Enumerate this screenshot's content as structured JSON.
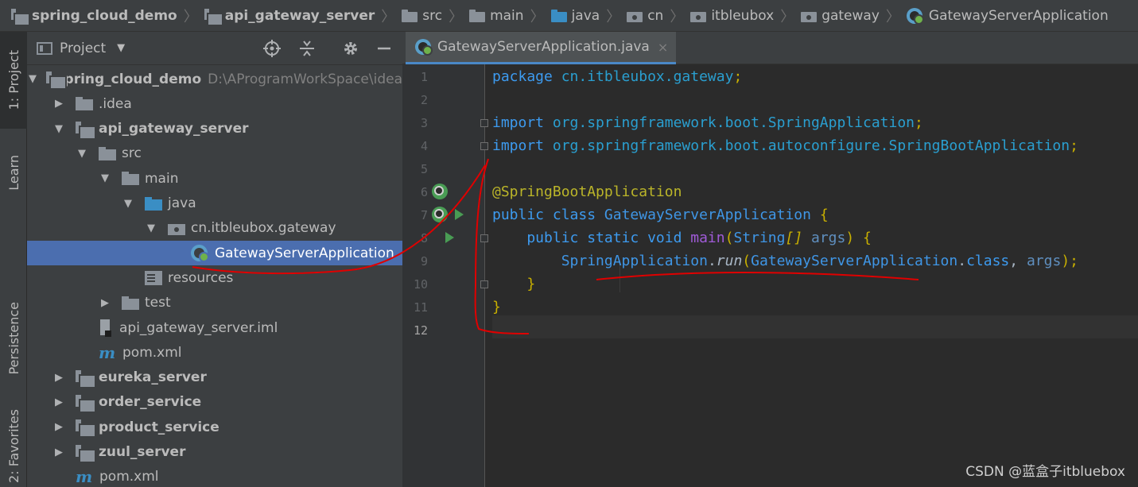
{
  "breadcrumb": [
    {
      "label": "spring_cloud_demo",
      "icon": "module-icon",
      "bold": true
    },
    {
      "label": "api_gateway_server",
      "icon": "module-icon",
      "bold": true
    },
    {
      "label": "src",
      "icon": "folder-icon",
      "bold": false
    },
    {
      "label": "main",
      "icon": "folder-icon",
      "bold": false
    },
    {
      "label": "java",
      "icon": "source-folder-icon",
      "bold": false
    },
    {
      "label": "cn",
      "icon": "package-icon",
      "bold": false
    },
    {
      "label": "itbleubox",
      "icon": "package-icon",
      "bold": false
    },
    {
      "label": "gateway",
      "icon": "package-icon",
      "bold": false
    },
    {
      "label": "GatewayServerApplication",
      "icon": "spring-boot-class-icon",
      "bold": false
    }
  ],
  "tool_strip": {
    "project_tab": "1: Project",
    "learn_tab": "Learn",
    "persistence_tab": "Persistence",
    "favorites_tab": "2: Favorites"
  },
  "project_panel": {
    "title": "Project",
    "dropdown_glyph": "▼",
    "tree": [
      {
        "label": "spring_cloud_demo",
        "path": "D:\\AProgramWorkSpace\\idea",
        "icon": "module",
        "arrow": "▼",
        "bold": true,
        "depth": 0
      },
      {
        "label": ".idea",
        "icon": "folder",
        "arrow": "▶",
        "bold": false,
        "depth": 1
      },
      {
        "label": "api_gateway_server",
        "icon": "module",
        "arrow": "▼",
        "bold": true,
        "depth": 1
      },
      {
        "label": "src",
        "icon": "folder",
        "arrow": "▼",
        "bold": false,
        "depth": 2
      },
      {
        "label": "main",
        "icon": "folder",
        "arrow": "▼",
        "bold": false,
        "depth": 3
      },
      {
        "label": "java",
        "icon": "folder-blue",
        "arrow": "▼",
        "bold": false,
        "depth": 4
      },
      {
        "label": "cn.itbleubox.gateway",
        "icon": "package",
        "arrow": "▼",
        "bold": false,
        "depth": 5
      },
      {
        "label": "GatewayServerApplication",
        "icon": "spring",
        "arrow": "",
        "bold": false,
        "depth": 6,
        "selected": true
      },
      {
        "label": "resources",
        "icon": "resources",
        "arrow": "",
        "bold": false,
        "depth": 4
      },
      {
        "label": "test",
        "icon": "folder",
        "arrow": "▶",
        "bold": false,
        "depth": 3
      },
      {
        "label": "api_gateway_server.iml",
        "icon": "iml",
        "arrow": "",
        "bold": false,
        "depth": 2
      },
      {
        "label": "pom.xml",
        "icon": "maven",
        "arrow": "",
        "bold": false,
        "depth": 2
      },
      {
        "label": "eureka_server",
        "icon": "module",
        "arrow": "▶",
        "bold": true,
        "depth": 1
      },
      {
        "label": "order_service",
        "icon": "module",
        "arrow": "▶",
        "bold": true,
        "depth": 1
      },
      {
        "label": "product_service",
        "icon": "module",
        "arrow": "▶",
        "bold": true,
        "depth": 1
      },
      {
        "label": "zuul_server",
        "icon": "module",
        "arrow": "▶",
        "bold": true,
        "depth": 1
      },
      {
        "label": "pom.xml",
        "icon": "maven",
        "arrow": "",
        "bold": false,
        "depth": 1
      }
    ]
  },
  "editor": {
    "tab_label": "GatewayServerApplication.java",
    "tab_close": "×",
    "line_numbers": [
      "1",
      "2",
      "3",
      "4",
      "5",
      "6",
      "7",
      "8",
      "9",
      "10",
      "11",
      "12"
    ],
    "current_line": 12,
    "lines": [
      [
        {
          "t": "package ",
          "c": "kw"
        },
        {
          "t": "cn.itbleubox.gateway",
          "c": "pkg"
        },
        {
          "t": ";",
          "c": "punc"
        }
      ],
      [],
      [
        {
          "t": "import ",
          "c": "kw"
        },
        {
          "t": "org.springframework.boot.SpringApplication",
          "c": "pkg"
        },
        {
          "t": ";",
          "c": "punc"
        }
      ],
      [
        {
          "t": "import ",
          "c": "kw"
        },
        {
          "t": "org.springframework.boot.autoconfigure.SpringBootApplication",
          "c": "pkg"
        },
        {
          "t": ";",
          "c": "punc"
        }
      ],
      [],
      [
        {
          "t": "@SpringBootApplication",
          "c": "ann"
        }
      ],
      [
        {
          "t": "public class ",
          "c": "kw"
        },
        {
          "t": "GatewayServerApplication ",
          "c": "cls"
        },
        {
          "t": "{",
          "c": "punc"
        }
      ],
      [
        {
          "t": "    public static void ",
          "c": "kw"
        },
        {
          "t": "main",
          "c": "fn"
        },
        {
          "t": "(",
          "c": "punc"
        },
        {
          "t": "String",
          "c": "cls"
        },
        {
          "t": "[] ",
          "c": "punc"
        },
        {
          "t": "args",
          "c": "var"
        },
        {
          "t": ") {",
          "c": "punc"
        }
      ],
      [
        {
          "t": "        SpringApplication",
          "c": "cls"
        },
        {
          "t": ".",
          "c": "plain"
        },
        {
          "t": "run",
          "c": "plain"
        },
        {
          "t": "(",
          "c": "punc"
        },
        {
          "t": "GatewayServerApplication",
          "c": "cls"
        },
        {
          "t": ".",
          "c": "plain"
        },
        {
          "t": "class",
          "c": "kw"
        },
        {
          "t": ", ",
          "c": "plain"
        },
        {
          "t": "args",
          "c": "var"
        },
        {
          "t": ");",
          "c": "punc"
        }
      ],
      [
        {
          "t": "    }",
          "c": "punc"
        }
      ],
      [
        {
          "t": "}",
          "c": "punc"
        }
      ],
      []
    ]
  },
  "watermark": "CSDN @蓝盒子itbluebox",
  "colors": {
    "panel_bg": "#3c3f41",
    "editor_bg": "#2b2b2b",
    "selection": "#4b6eaf",
    "annotation_red": "#e00000"
  }
}
